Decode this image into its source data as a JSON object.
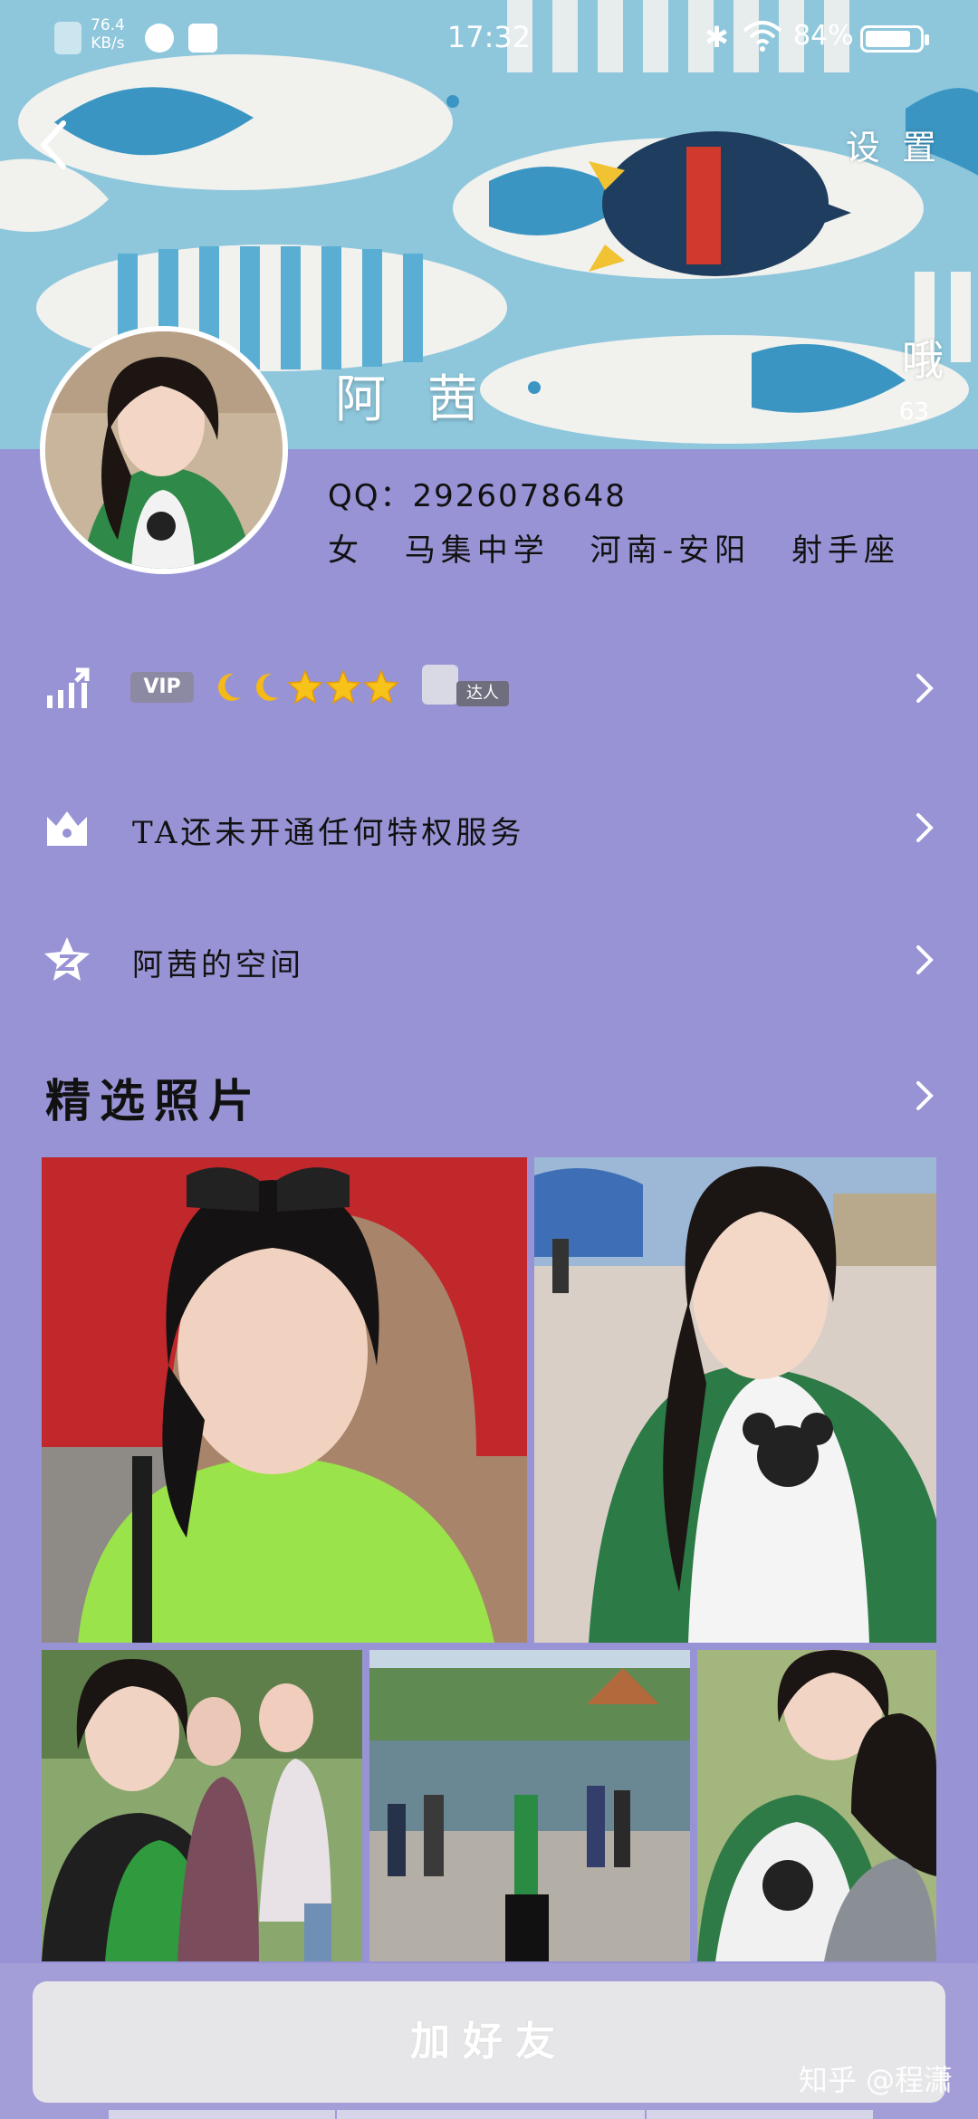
{
  "status_bar": {
    "net_speed_value": "76.4",
    "net_speed_unit": "KB/s",
    "time": "17:32",
    "battery_percent": "84%",
    "battery_level": 0.84
  },
  "header": {
    "settings_label": "设 置",
    "poke_label": "哦",
    "poke_count": "63",
    "nickname": "阿 茜"
  },
  "profile": {
    "qq_label": "QQ：",
    "qq_number": "2926078648",
    "gender": "女",
    "school": "马集中学",
    "location": "河南-安阳",
    "zodiac": "射手座"
  },
  "rows": {
    "level": {
      "vip_label": "VIP",
      "talent_label": "达人",
      "icons": [
        "moon-icon",
        "moon-icon",
        "star-icon",
        "star-icon",
        "star-icon"
      ]
    },
    "privilege": {
      "label": "TA还未开通任何特权服务"
    },
    "space": {
      "label": "阿茜的空间"
    }
  },
  "photos_section": {
    "title": "精选照片"
  },
  "bottom": {
    "add_friend_label": "加好友",
    "watermark": "知乎 @程潇"
  },
  "colors": {
    "background": "#9893d4",
    "banner": "#8ec7dc",
    "button": "#e6e6e8"
  }
}
